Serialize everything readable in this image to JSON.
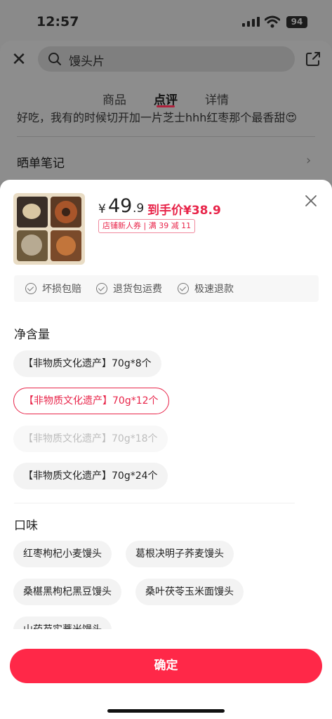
{
  "status_bar": {
    "time": "12:57",
    "battery": "94"
  },
  "top": {
    "search_query": "馒头片",
    "tabs": [
      {
        "label": "商品"
      },
      {
        "label": "点评"
      },
      {
        "label": "详情"
      }
    ],
    "active_tab": "点评",
    "review_snippet": "好吃，我有的时候切开加一片芝士hhh红枣那个最香甜😍",
    "notes_title": "晒单笔记"
  },
  "product": {
    "currency": "¥",
    "price_int": "49",
    "price_dec": ".9",
    "final_price": "到手价¥38.9",
    "coupon": "店铺新人券 | 满 39 减 11"
  },
  "guarantees": [
    "坏损包赔",
    "退货包运费",
    "极速退款"
  ],
  "net_content": {
    "title": "净含量",
    "options": [
      {
        "label": "【非物质文化遗产】70g*8个",
        "state": "normal"
      },
      {
        "label": "【非物质文化遗产】70g*12个",
        "state": "selected"
      },
      {
        "label": "【非物质文化遗产】70g*18个",
        "state": "disabled"
      },
      {
        "label": "【非物质文化遗产】70g*24个",
        "state": "normal"
      }
    ]
  },
  "flavor": {
    "title": "口味",
    "options": [
      {
        "label": "红枣枸杞小麦馒头"
      },
      {
        "label": "葛根决明子荞麦馒头"
      },
      {
        "label": "桑椹黑枸杞黑豆馒头"
      },
      {
        "label": "桑叶茯苓玉米面馒头"
      },
      {
        "label": "山药芡实薏米馒头"
      }
    ]
  },
  "confirm_label": "确定",
  "colors": {
    "accent": "#ff2848",
    "price_red": "#e8254a"
  }
}
